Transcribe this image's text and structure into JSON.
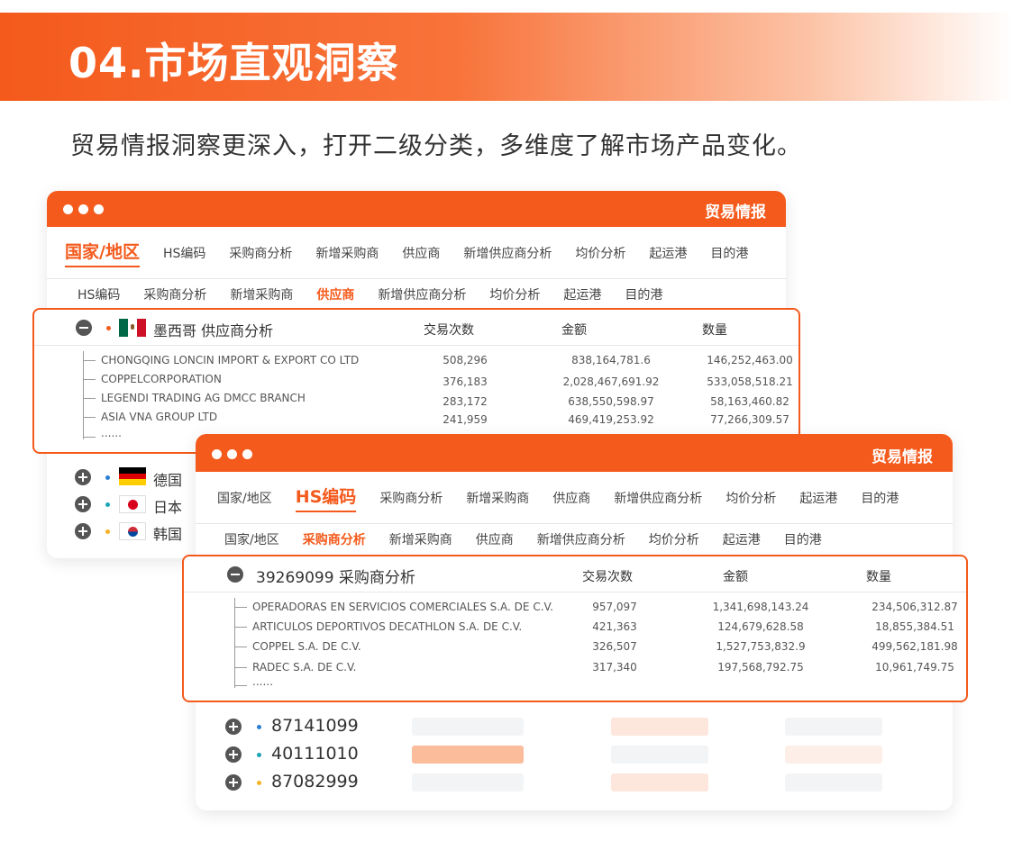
{
  "banner": {
    "title": "04.市场直观洞察"
  },
  "subtitle": "贸易情报洞察更深入，打开二级分类，多维度了解市场产品变化。",
  "window1": {
    "title": "贸易情报",
    "nav_primary": [
      "国家/地区",
      "HS编码",
      "采购商分析",
      "新增采购商",
      "供应商",
      "新增供应商分析",
      "均价分析",
      "起运港",
      "目的港"
    ],
    "nav_secondary": [
      "HS编码",
      "采购商分析",
      "新增采购商",
      "供应商",
      "新增供应商分析",
      "均价分析",
      "起运港",
      "目的港"
    ],
    "panel": {
      "title": "墨西哥 供应商分析",
      "columns": [
        "交易次数",
        "金额",
        "数量"
      ],
      "rows": [
        {
          "name": "CHONGQING LONCIN IMPORT & EXPORT CO LTD",
          "count": "508,296",
          "amount": "838,164,781.6",
          "qty": "146,252,463.00"
        },
        {
          "name": "COPPELCORPORATION",
          "count": "376,183",
          "amount": "2,028,467,691.92",
          "qty": "533,058,518.21"
        },
        {
          "name": "LEGENDI TRADING AG DMCC BRANCH",
          "count": "283,172",
          "amount": "638,550,598.97",
          "qty": "58,163,460.82"
        },
        {
          "name": "ASIA VNA GROUP LTD",
          "count": "241,959",
          "amount": "469,419,253.92",
          "qty": "77,266,309.57"
        }
      ],
      "more": "......"
    },
    "countries": [
      "德国",
      "日本",
      "韩国"
    ]
  },
  "window2": {
    "title": "贸易情报",
    "nav_primary": [
      "国家/地区",
      "HS编码",
      "采购商分析",
      "新增采购商",
      "供应商",
      "新增供应商分析",
      "均价分析",
      "起运港",
      "目的港"
    ],
    "nav_secondary": [
      "国家/地区",
      "采购商分析",
      "新增采购商",
      "供应商",
      "新增供应商分析",
      "均价分析",
      "起运港",
      "目的港"
    ],
    "panel": {
      "title": "39269099 采购商分析",
      "columns": [
        "交易次数",
        "金额",
        "数量"
      ],
      "rows": [
        {
          "name": "OPERADORAS EN SERVICIOS COMERCIALES S.A. DE C.V.",
          "count": "957,097",
          "amount": "1,341,698,143.24",
          "qty": "234,506,312.87"
        },
        {
          "name": "ARTICULOS DEPORTIVOS DECATHLON S.A. DE C.V.",
          "count": "421,363",
          "amount": "124,679,628.58",
          "qty": "18,855,384.51"
        },
        {
          "name": "COPPEL S.A. DE C.V.",
          "count": "326,507",
          "amount": "1,527,753,832.9",
          "qty": "499,562,181.98"
        },
        {
          "name": "RADEC S.A. DE C.V.",
          "count": "317,340",
          "amount": "197,568,792.75",
          "qty": "10,961,749.75"
        }
      ],
      "more": "......"
    },
    "codes": [
      "87141099",
      "40111010",
      "87082999"
    ]
  },
  "colors": {
    "accent": "#f45a1c",
    "bullet_red": "#f45a1c",
    "bullet_blue": "#2a7fd4",
    "bullet_teal": "#1aa6b7",
    "bullet_yellow": "#f5b324"
  }
}
